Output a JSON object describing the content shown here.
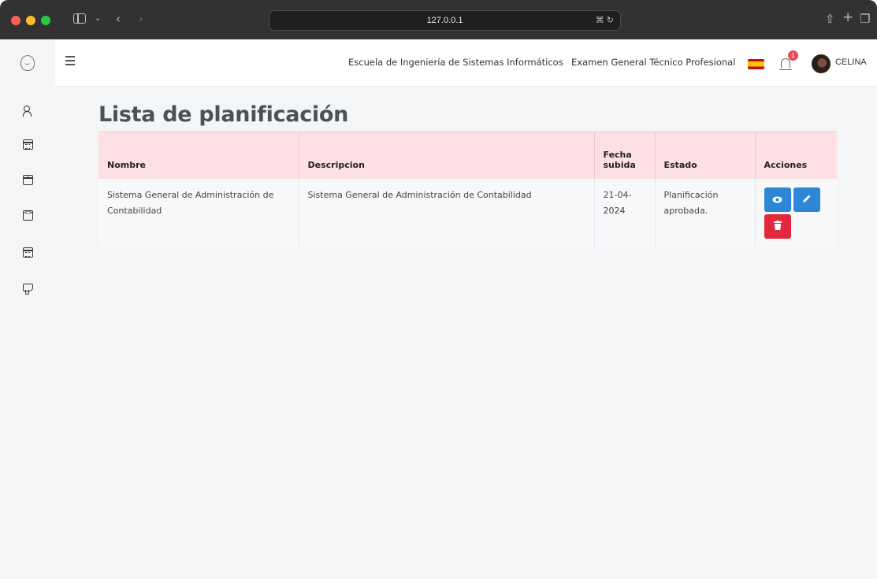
{
  "browser": {
    "url": "127.0.0.1"
  },
  "header": {
    "school": "Escuela de Ingeniería de Sistemas Informáticos",
    "exam": "Examen General Técnico Profesional",
    "notifications_count": "1",
    "username": "CELINA"
  },
  "page": {
    "title": "Lista de planificación"
  },
  "table": {
    "columns": [
      "Nombre",
      "Descripcion",
      "Fecha subida",
      "Estado",
      "Acciones"
    ],
    "rows": [
      {
        "nombre": "Sistema General de Administración de Contabilidad",
        "descripcion": "Sistema General de Administración de Contabilidad",
        "fecha": "21-04-2024",
        "estado": "Planificación aprobada."
      }
    ]
  },
  "colors": {
    "header_row": "#fde0e3",
    "primary_button": "#2e86d6",
    "danger_button": "#e2283d",
    "badge": "#e74c5a"
  },
  "icons": [
    "sidebar-toggle-icon",
    "back-icon",
    "forward-icon",
    "translate-icon",
    "reload-icon",
    "share-icon",
    "new-tab-icon",
    "tabs-icon",
    "logo-icon",
    "menu-icon",
    "bell-icon",
    "users-icon",
    "calendar-icon",
    "check-calendar-icon",
    "code-icon",
    "thumbs-down-icon",
    "eye-icon",
    "pencil-icon",
    "trash-icon"
  ]
}
